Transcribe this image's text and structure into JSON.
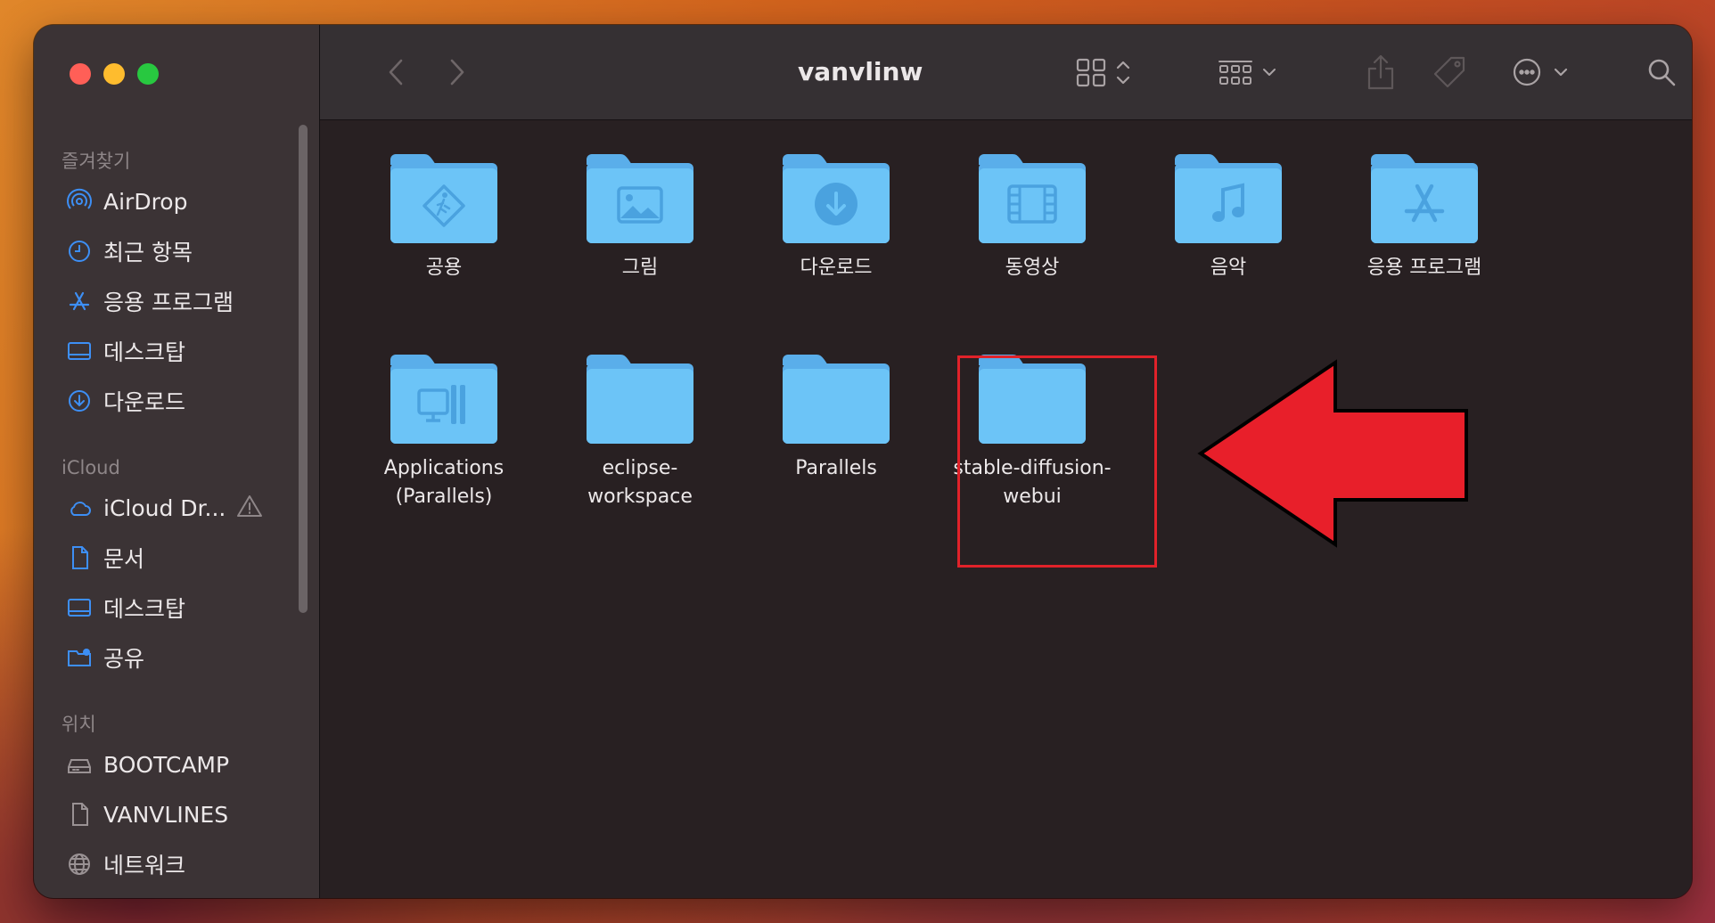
{
  "window": {
    "title": "vanvlinw"
  },
  "sidebar": {
    "sections": [
      {
        "heading": "즐겨찾기",
        "items": [
          {
            "label": "AirDrop",
            "icon": "airdrop-icon"
          },
          {
            "label": "최근 항목",
            "icon": "clock-icon"
          },
          {
            "label": "응용 프로그램",
            "icon": "apps-icon"
          },
          {
            "label": "데스크탑",
            "icon": "desktop-icon"
          },
          {
            "label": "다운로드",
            "icon": "download-icon"
          }
        ]
      },
      {
        "heading": "iCloud",
        "items": [
          {
            "label": "iCloud Dr...",
            "icon": "cloud-icon"
          },
          {
            "label": "문서",
            "icon": "document-icon"
          },
          {
            "label": "데스크탑",
            "icon": "desktop-icon"
          },
          {
            "label": "공유",
            "icon": "shared-folder-icon"
          }
        ]
      },
      {
        "heading": "위치",
        "items": [
          {
            "label": "BOOTCAMP",
            "icon": "drive-icon"
          },
          {
            "label": "VANVLINES",
            "icon": "document-icon"
          },
          {
            "label": "네트워크",
            "icon": "network-icon"
          }
        ]
      }
    ]
  },
  "files": [
    {
      "name": "공용",
      "icon": "public-folder-icon"
    },
    {
      "name": "그림",
      "icon": "pictures-folder-icon"
    },
    {
      "name": "다운로드",
      "icon": "downloads-folder-icon"
    },
    {
      "name": "동영상",
      "icon": "movies-folder-icon"
    },
    {
      "name": "음악",
      "icon": "music-folder-icon"
    },
    {
      "name": "응용 프로그램",
      "icon": "applications-folder-icon"
    },
    {
      "name": "Applications\n(Parallels)",
      "icon": "parallels-apps-folder-icon"
    },
    {
      "name": "eclipse-\nworkspace",
      "icon": "folder-icon"
    },
    {
      "name": "Parallels",
      "icon": "folder-icon"
    },
    {
      "name": "stable-diffusion-\nwebui",
      "icon": "folder-icon",
      "highlighted": true
    }
  ],
  "colors": {
    "accent": "#3d8ff5",
    "folder": "#6cc4f7",
    "highlight": "#e0222a",
    "arrow": "#e81f2a"
  }
}
